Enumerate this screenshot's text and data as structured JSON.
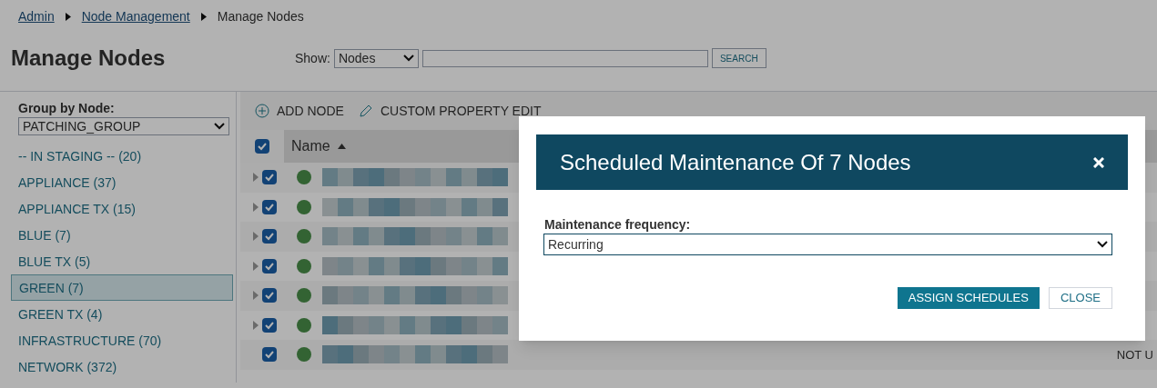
{
  "breadcrumb": [
    {
      "label": "Admin"
    },
    {
      "label": "Node Management"
    },
    {
      "label": "Manage Nodes"
    }
  ],
  "page_title": "Manage Nodes",
  "show": {
    "label": "Show:",
    "value": "Nodes",
    "search_button": "SEARCH"
  },
  "sidebar": {
    "title": "Group by Node:",
    "group_by": "PATCHING_GROUP",
    "items": [
      {
        "label": "-- IN STAGING -- (20)",
        "selected": false
      },
      {
        "label": "APPLIANCE (37)",
        "selected": false
      },
      {
        "label": "APPLIANCE TX (15)",
        "selected": false
      },
      {
        "label": "BLUE (7)",
        "selected": false
      },
      {
        "label": "BLUE TX (5)",
        "selected": false
      },
      {
        "label": "GREEN (7)",
        "selected": true
      },
      {
        "label": "GREEN TX (4)",
        "selected": false
      },
      {
        "label": "INFRASTRUCTURE (70)",
        "selected": false
      },
      {
        "label": "NETWORK (372)",
        "selected": false
      }
    ]
  },
  "toolbar": [
    {
      "label": "ADD NODE",
      "kind": "add"
    },
    {
      "label": "CUSTOM PROPERTY EDIT",
      "kind": "edit"
    }
  ],
  "table": {
    "select_all": true,
    "name_column": "Name",
    "rows": [
      {
        "checked": true,
        "expandable": true
      },
      {
        "checked": true,
        "expandable": true
      },
      {
        "checked": true,
        "expandable": true
      },
      {
        "checked": true,
        "expandable": true
      },
      {
        "checked": true,
        "expandable": true
      },
      {
        "checked": true,
        "expandable": true
      },
      {
        "checked": true,
        "expandable": false,
        "status": "NOT U"
      }
    ]
  },
  "dialog": {
    "title": "Scheduled Maintenance Of 7 Nodes",
    "field_label": "Maintenance frequency:",
    "field_value": "Recurring",
    "buttons": [
      {
        "label": "ASSIGN SCHEDULES",
        "kind": "primary"
      },
      {
        "label": "CLOSE",
        "kind": "secondary"
      }
    ]
  }
}
